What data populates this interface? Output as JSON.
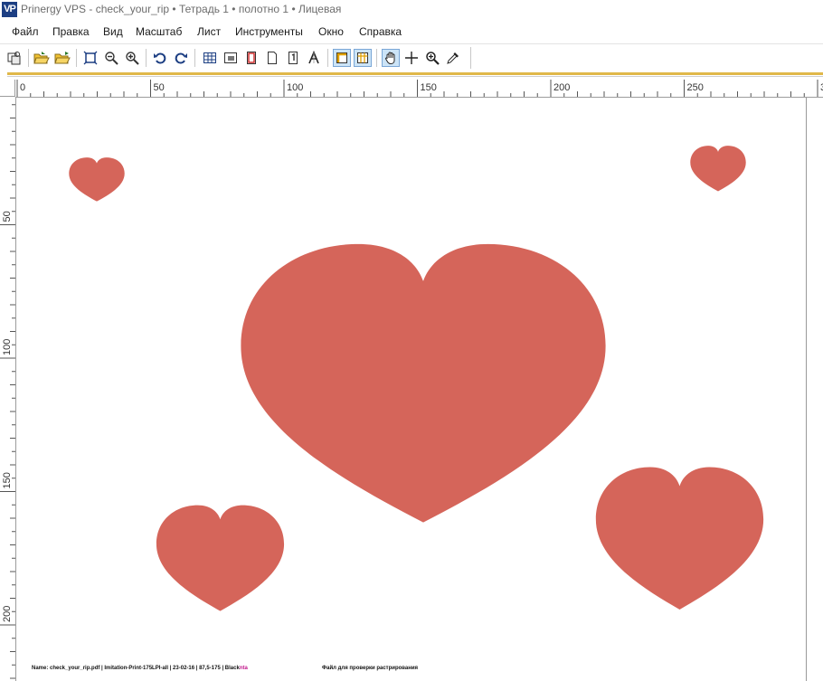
{
  "window": {
    "app_icon": "VP",
    "title": "Prinergy VPS - check_your_rip • Тетрадь 1 • полотно 1 • Лицевая"
  },
  "menu": {
    "items": [
      "Файл",
      "Правка",
      "Вид",
      "Масштаб",
      "Лист",
      "Инструменты",
      "Окно",
      "Справка"
    ]
  },
  "toolbar": {
    "buttons": [
      "job-icon",
      "open-folder-icon",
      "open-folder-alt-icon",
      "fit-page-icon",
      "zoom-out-icon",
      "zoom-in-icon",
      "rotate-left-icon",
      "rotate-right-icon",
      "grid-icon",
      "frame-icon",
      "red-frame-icon",
      "page-icon",
      "page-number-icon",
      "text-tool-icon",
      "bleed-box-icon",
      "trim-box-icon",
      "hand-tool-icon",
      "crosshair-icon",
      "zoom-tool-icon",
      "eyedropper-icon"
    ],
    "active": [
      "bleed-box-icon",
      "trim-box-icon",
      "hand-tool-icon"
    ]
  },
  "ruler": {
    "horizontal_labels": [
      "0",
      "50",
      "100",
      "150",
      "200",
      "250",
      "3"
    ],
    "vertical_labels": [
      "50",
      "100",
      "150",
      "200"
    ]
  },
  "canvas": {
    "heart_color": "#d5655a",
    "hearts": [
      "small-heart-top-left",
      "small-heart-top-right",
      "large-heart-center",
      "medium-heart-bottom-left",
      "medium-heart-bottom-right"
    ]
  },
  "footer": {
    "slug_text": "Name: check_your_rip.pdf | Imitation-Print-175LPI-all | 23-02-16 | 87,5-175 | Black",
    "slug_color_text": "nta",
    "caption": "Файл для проверки растрирования"
  }
}
